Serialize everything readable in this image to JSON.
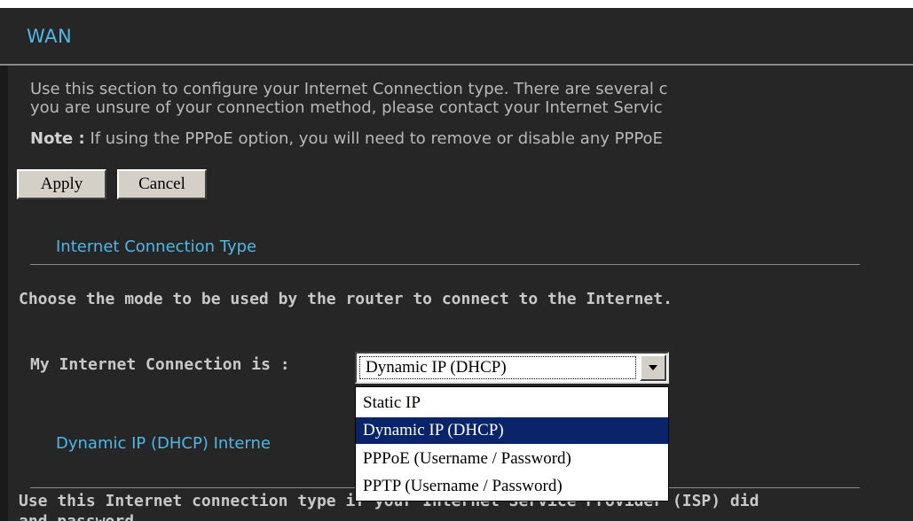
{
  "section": {
    "title": "WAN"
  },
  "intro": {
    "line1": "Use this section to configure your Internet Connection type. There are several c",
    "line2": "you are unsure of your connection method, please contact your Internet Servic",
    "note_label": "Note :",
    "note_text": " If using the PPPoE option, you will need to remove or disable any PPPoE"
  },
  "buttons": {
    "apply": "Apply",
    "cancel": "Cancel"
  },
  "connection_type": {
    "heading": "Internet Connection Type",
    "description": "Choose the mode to be used by the router to connect to the Internet.",
    "field_label": "My Internet Connection is :",
    "selected": "Dynamic IP (DHCP)",
    "options": [
      "Static IP",
      "Dynamic IP (DHCP)",
      "PPPoE (Username / Password)",
      "PPTP (Username / Password)"
    ]
  },
  "dhcp_section": {
    "heading": "Dynamic IP (DHCP) Interne",
    "description_line1": "Use this Internet connection type if your Internet Service Provider (ISP) did",
    "description_line2": "and password."
  },
  "colors": {
    "background": "#262626",
    "heading_blue": "#4db8e8",
    "selection_highlight": "#0a246a"
  },
  "icons": {
    "dropdown_arrow": "chevron-down-icon"
  }
}
